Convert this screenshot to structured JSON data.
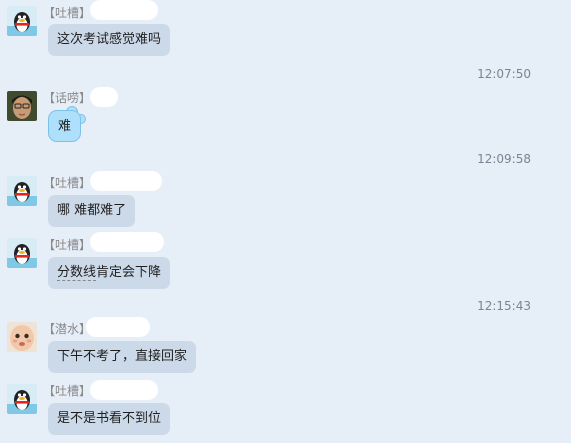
{
  "messages": [
    {
      "nick": "【吐槽】",
      "text": "这次考试感觉难吗",
      "avatar_icon": "penguin-avatar-icon"
    },
    {
      "nick": "【话唠】",
      "text": "难",
      "avatar_icon": "photo-avatar-icon"
    },
    {
      "nick": "【吐槽】",
      "text": "哪 难都难了",
      "avatar_icon": "penguin-avatar-icon"
    },
    {
      "nick": "【吐槽】",
      "text_underlined": "分数线",
      "text_rest": "肯定会下降",
      "avatar_icon": "penguin-avatar-icon"
    },
    {
      "nick": "【潜水】",
      "text": "下午不考了，直接回家",
      "avatar_icon": "baby-avatar-icon"
    },
    {
      "nick": "【吐槽】",
      "text": "是不是书看不到位",
      "avatar_icon": "penguin-avatar-icon"
    }
  ],
  "timestamps": [
    "12:07:50",
    "12:09:58",
    "12:15:43"
  ],
  "colors": {
    "background": "#e6eef8",
    "bubble": "#ccd9e8",
    "bubble_highlight": "#aee0fb",
    "nick": "#8a8a8a",
    "time": "#7a8594"
  }
}
